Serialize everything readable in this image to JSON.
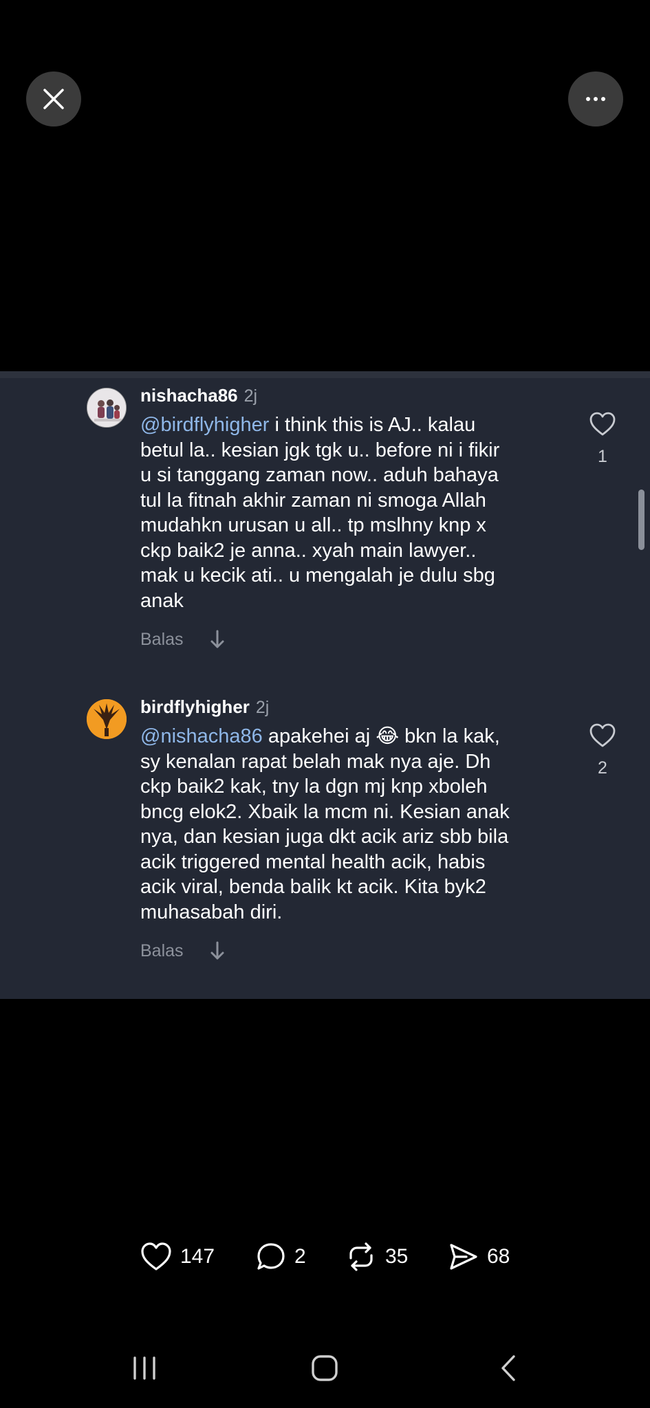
{
  "top_bar": {
    "close_icon": "close-icon",
    "more_icon": "more-horizontal-icon"
  },
  "comments": [
    {
      "username": "nishacha86",
      "time": "2j",
      "mention": "@birdflyhigher",
      "text": " i think this is AJ.. kalau\nbetul la.. kesian jgk tgk u.. before ni i fikir\nu si tanggang zaman now.. aduh bahaya\ntul la fitnah akhir zaman ni smoga Allah\nmudahkn urusan u all.. tp mslhny knp x\nckp baik2 je anna.. xyah main lawyer..\nmak u kecik ati.. u mengalah je dulu sbg\nanak",
      "likes": "1",
      "reply_label": "Balas"
    },
    {
      "username": "birdflyhigher",
      "time": "2j",
      "mention": "@nishacha86",
      "text": " apakehei aj 😂 bkn la kak,\nsy kenalan rapat belah mak nya aje.  Dh\nckp baik2 kak, tny la dgn mj knp xboleh\nbncg elok2. Xbaik la mcm ni. Kesian anak\nnya, dan kesian juga dkt acik ariz sbb bila\nacik triggered mental health acik, habis\nacik viral, benda balik kt acik. Kita byk2\nmuhasabah diri.",
      "likes": "2",
      "reply_label": "Balas"
    }
  ],
  "actions": {
    "likes": "147",
    "comments": "2",
    "reposts": "35",
    "shares": "68"
  },
  "colors": {
    "background": "#000000",
    "panel": "#232834",
    "mention": "#8fb7e8",
    "muted": "#8c919b"
  }
}
